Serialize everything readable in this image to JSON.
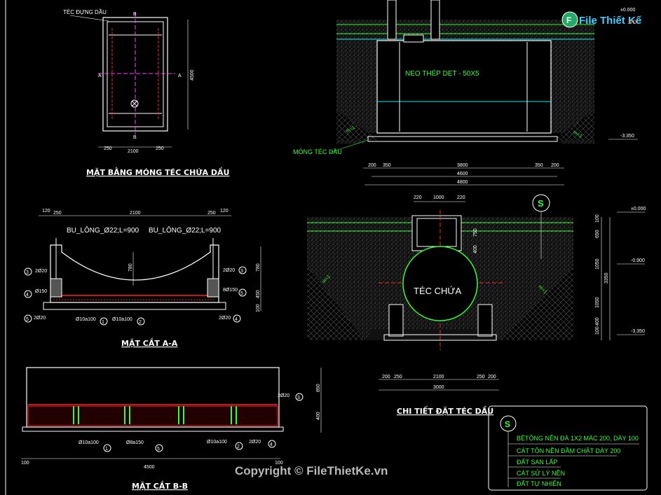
{
  "brand": {
    "logo_text": "File Thiết Kế",
    "logo_suffix": ".vn"
  },
  "watermark": "Copyright © FileThietKe.vn",
  "plan": {
    "title": "MẶT BẰNG MÓNG TÉC CHỨA DẦU",
    "tank_label": "TÉC ĐỰNG DẦU",
    "cut_a": "A",
    "cut_b": "B",
    "dim_height": "4500",
    "dims_bottom": [
      "250",
      "2100",
      "250"
    ]
  },
  "section_aa": {
    "title": "MẶT CẮT A-A",
    "dims_top": [
      "120",
      "250",
      "2100",
      "250",
      "120"
    ],
    "bolt_left": "BU_LÔNG_Ø22;L=900",
    "bolt_right": "BU_LÔNG_Ø22;L=900",
    "dim_arc": "780",
    "dims_right": [
      "780",
      "450",
      "100"
    ],
    "bars": {
      "b2_left": "2Ø20",
      "b2_right": "2Ø20",
      "b5_left": "Ø150",
      "b5_right": "8Ø150",
      "b2b_left": "2Ø20",
      "b2b_right": "2Ø20",
      "b1": "Ø10a100",
      "b2": "Ø10a100"
    },
    "markers": [
      "1",
      "2",
      "3",
      "4",
      "5"
    ]
  },
  "section_bb": {
    "title": "MẶT CẮT B-B",
    "bars": {
      "top": "2Ø20",
      "b1": "Ø10a100",
      "b5": "Ø8a150",
      "b2": "Ø10a100",
      "b4": "2Ø20"
    },
    "dims_right": [
      "850",
      "400"
    ],
    "dims_bottom": [
      "100",
      "4500",
      "100"
    ],
    "markers": [
      "1",
      "2",
      "3",
      "4",
      "5"
    ]
  },
  "long_section": {
    "anchor": "NEO THÉP DẸT - 50X5",
    "foundation": "MÓNG TÉC DẦU",
    "slope": "m=1",
    "level_top": "±0.000",
    "level_bottom": "-3.350",
    "dims_row1": [
      "200",
      "350",
      "3800",
      "350",
      "200"
    ],
    "dims_row2": "4600",
    "dims_row3": "4800"
  },
  "cross_section": {
    "title": "CHI TIẾT ĐẶT TÉC DẦU",
    "tank_text": "TÉC CHỨA",
    "marker": "S",
    "slope": "m=1",
    "dims_top": [
      "220",
      "1000",
      "220"
    ],
    "dims_vert_inner": [
      "750",
      "400"
    ],
    "dims_right": [
      "100",
      "650",
      "1050",
      "1050",
      "100",
      "400"
    ],
    "dim_total": "3350",
    "levels": [
      "±0.000",
      "-0.900",
      "-3.350"
    ],
    "dims_bottom": [
      "200",
      "250",
      "2100",
      "250",
      "200"
    ],
    "dim_bottom_total": "3000"
  },
  "legend": {
    "marker": "S",
    "items": [
      "BÊTÔNG NỀN ĐÁ 1X2 MÁC 200, DÀY 100",
      "CÁT TÔN NỀN ĐẦM CHẶT DÀY 200",
      "ĐẤT SAN LẤP",
      "CÁT SỬ LÝ NỀN",
      "ĐẤT TỰ NHIÊN"
    ]
  },
  "colors": {
    "background": "#000000",
    "line": "#ffffff",
    "green": "#33ff33",
    "cyan": "#00e5e5",
    "red": "#ff2020",
    "yellow": "#ffff00",
    "magenta": "#ff40ff"
  }
}
